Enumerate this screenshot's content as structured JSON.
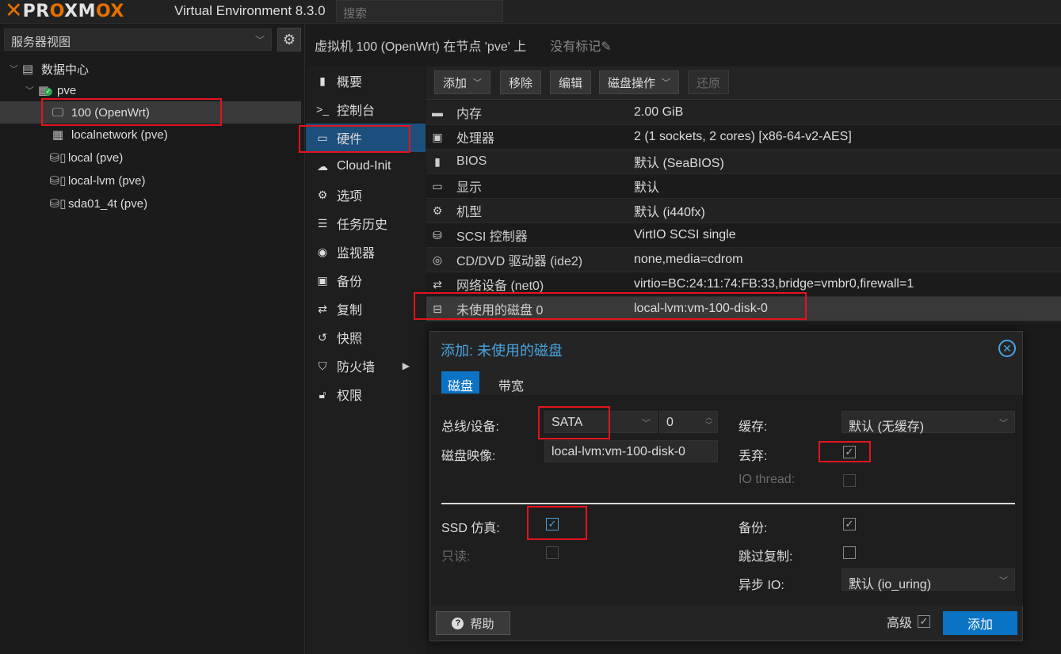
{
  "app": {
    "version": "Virtual Environment 8.3.0",
    "search_placeholder": "搜索"
  },
  "sidebar": {
    "view": "服务器视图",
    "tree": [
      {
        "label": "数据中心",
        "icon": "datacenter-icon"
      },
      {
        "label": "pve",
        "icon": "node-icon"
      },
      {
        "label": "100 (OpenWrt)",
        "icon": "vm-monitor-icon",
        "selected": true
      },
      {
        "label": "localnetwork (pve)",
        "icon": "network-grid-icon"
      },
      {
        "label": "local (pve)",
        "icon": "storage-icon"
      },
      {
        "label": "local-lvm (pve)",
        "icon": "storage-icon"
      },
      {
        "label": "sda01_4t (pve)",
        "icon": "storage-icon"
      }
    ]
  },
  "header": {
    "title": "虚拟机 100 (OpenWrt) 在节点 'pve' 上",
    "tags": "没有标记"
  },
  "nav": [
    {
      "label": "概要",
      "icon": "book-icon"
    },
    {
      "label": "控制台",
      "icon": "terminal-icon"
    },
    {
      "label": "硬件",
      "icon": "monitor-icon",
      "active": true
    },
    {
      "label": "Cloud-Init",
      "icon": "cloud-icon"
    },
    {
      "label": "选项",
      "icon": "gear-icon"
    },
    {
      "label": "任务历史",
      "icon": "list-icon"
    },
    {
      "label": "监视器",
      "icon": "eye-icon"
    },
    {
      "label": "备份",
      "icon": "floppy-icon"
    },
    {
      "label": "复制",
      "icon": "retweet-icon"
    },
    {
      "label": "快照",
      "icon": "history-icon"
    },
    {
      "label": "防火墙",
      "icon": "shield-icon"
    },
    {
      "label": "权限",
      "icon": "unlock-icon"
    }
  ],
  "toolbar": {
    "add": "添加",
    "remove": "移除",
    "edit": "编辑",
    "disk_action": "磁盘操作",
    "revert": "还原"
  },
  "hardware": [
    {
      "key": "内存",
      "value": "2.00 GiB",
      "icon": "memory-icon"
    },
    {
      "key": "处理器",
      "value": "2 (1 sockets, 2 cores) [x86-64-v2-AES]",
      "icon": "cpu-icon"
    },
    {
      "key": "BIOS",
      "value": "默认 (SeaBIOS)",
      "icon": "microchip-icon"
    },
    {
      "key": "显示",
      "value": "默认",
      "icon": "desktop-icon"
    },
    {
      "key": "机型",
      "value": "默认 (i440fx)",
      "icon": "cogs-icon"
    },
    {
      "key": "SCSI 控制器",
      "value": "VirtIO SCSI single",
      "icon": "database-icon"
    },
    {
      "key": "CD/DVD 驱动器 (ide2)",
      "value": "none,media=cdrom",
      "icon": "cdrom-icon"
    },
    {
      "key": "网络设备 (net0)",
      "value": "virtio=BC:24:11:74:FB:33,bridge=vmbr0,firewall=1",
      "icon": "exchange-icon"
    },
    {
      "key": "未使用的磁盘 0",
      "value": "local-lvm:vm-100-disk-0",
      "icon": "hdd-icon",
      "selected": true
    }
  ],
  "dialog": {
    "title": "添加: 未使用的磁盘",
    "tabs": [
      "磁盘",
      "带宽"
    ],
    "bus_label": "总线/设备:",
    "bus_value": "SATA",
    "device_index": "0",
    "image_label": "磁盘映像:",
    "image_value": "local-lvm:vm-100-disk-0",
    "cache_label": "缓存:",
    "cache_value": "默认 (无缓存)",
    "discard_label": "丢弃:",
    "iothread_label": "IO thread:",
    "ssd_label": "SSD 仿真:",
    "readonly_label": "只读:",
    "backup_label": "备份:",
    "skip_repl_label": "跳过复制:",
    "async_label": "异步 IO:",
    "async_value": "默认 (io_uring)",
    "help": "帮助",
    "advanced": "高级",
    "add": "添加",
    "checks": {
      "discard": true,
      "iothread": false,
      "ssd": true,
      "readonly": false,
      "backup": true,
      "skip_replication": false,
      "advanced": true
    }
  },
  "colors": {
    "accent": "#0a73c4",
    "highlight": "#e3141b",
    "brand_orange": "#e57000"
  }
}
